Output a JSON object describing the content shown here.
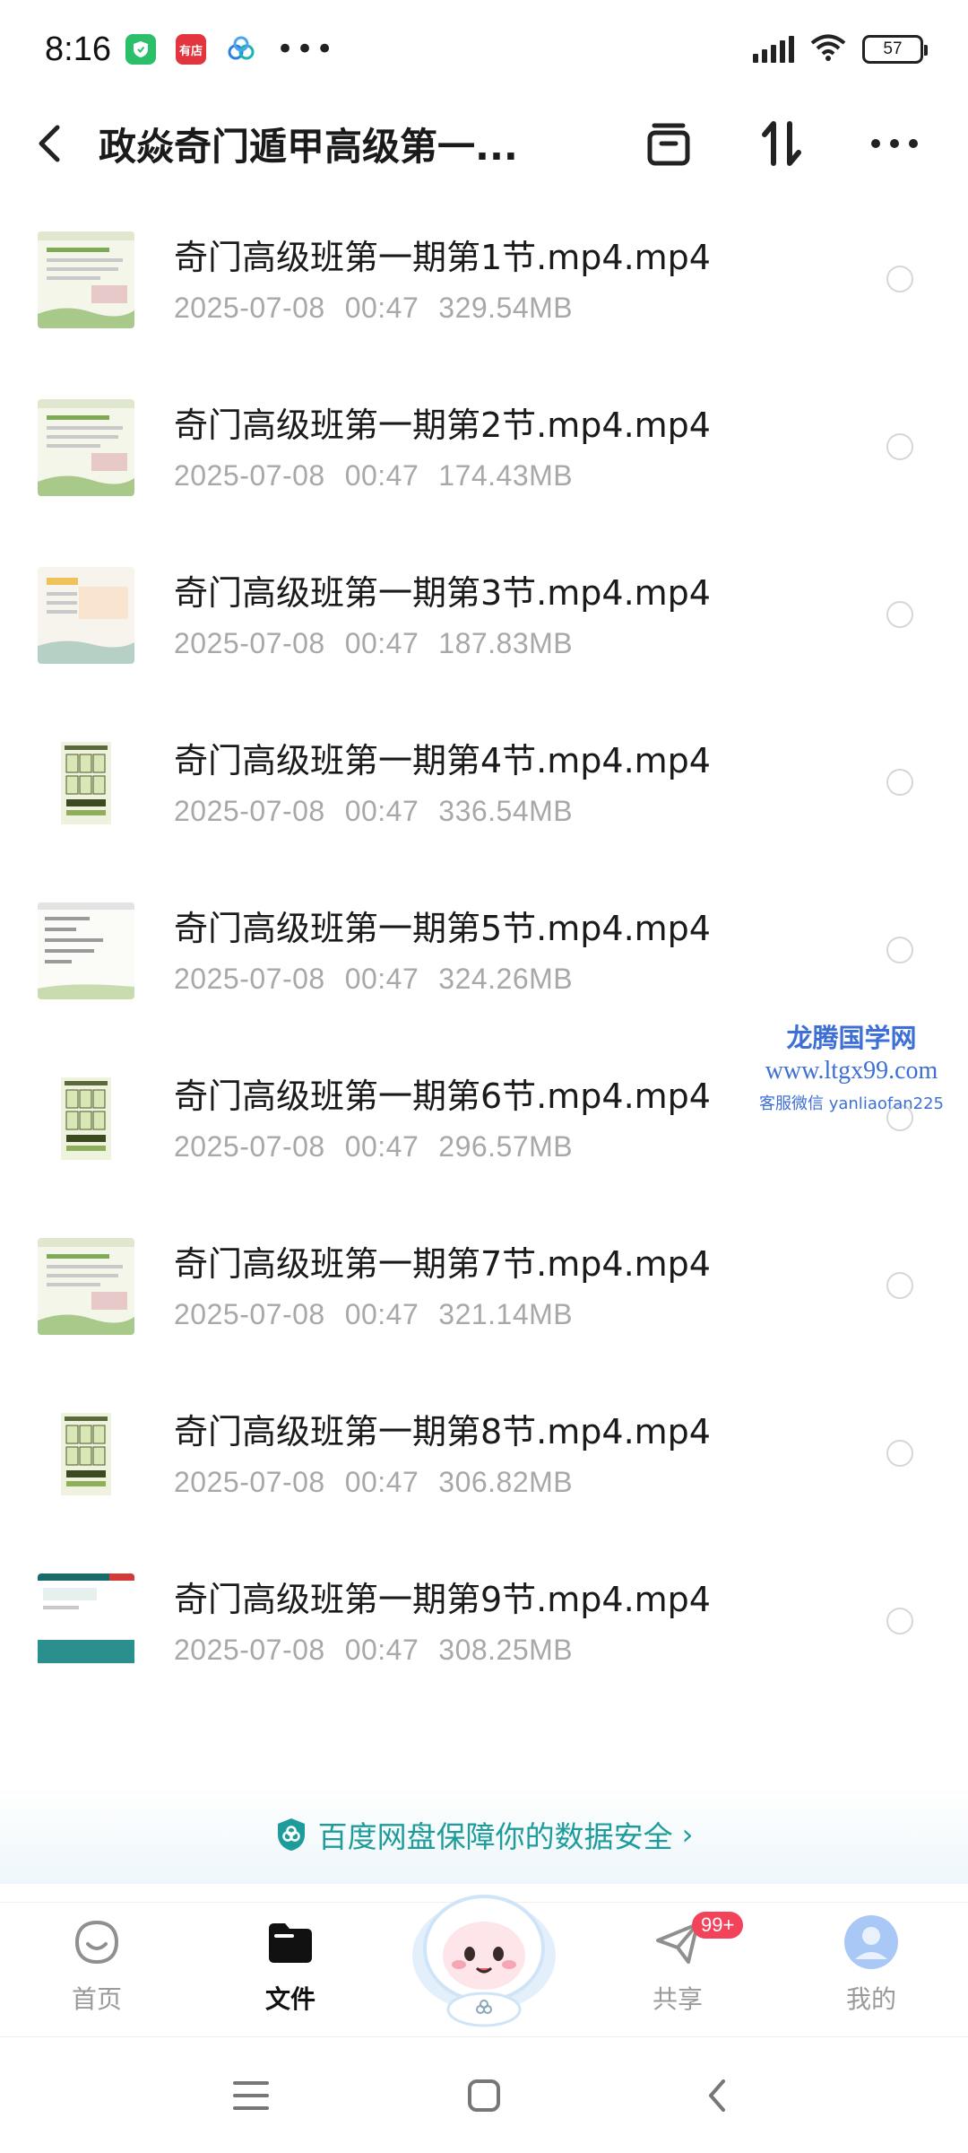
{
  "status_bar": {
    "time": "8:16",
    "notif_red_label": "有店",
    "dots": "•••",
    "battery": "57"
  },
  "header": {
    "title": "政焱奇门遁甲高级第一..."
  },
  "files": [
    {
      "name": "奇门高级班第一期第1节.mp4.mp4",
      "date": "2025-07-08",
      "time": "00:47",
      "size": "329.54MB",
      "thumb": "green"
    },
    {
      "name": "奇门高级班第一期第2节.mp4.mp4",
      "date": "2025-07-08",
      "time": "00:47",
      "size": "174.43MB",
      "thumb": "green"
    },
    {
      "name": "奇门高级班第一期第3节.mp4.mp4",
      "date": "2025-07-08",
      "time": "00:47",
      "size": "187.83MB",
      "thumb": "orange"
    },
    {
      "name": "奇门高级班第一期第4节.mp4.mp4",
      "date": "2025-07-08",
      "time": "00:47",
      "size": "336.54MB",
      "thumb": "chart"
    },
    {
      "name": "奇门高级班第一期第5节.mp4.mp4",
      "date": "2025-07-08",
      "time": "00:47",
      "size": "324.26MB",
      "thumb": "text"
    },
    {
      "name": "奇门高级班第一期第6节.mp4.mp4",
      "date": "2025-07-08",
      "time": "00:47",
      "size": "296.57MB",
      "thumb": "chart"
    },
    {
      "name": "奇门高级班第一期第7节.mp4.mp4",
      "date": "2025-07-08",
      "time": "00:47",
      "size": "321.14MB",
      "thumb": "green"
    },
    {
      "name": "奇门高级班第一期第8节.mp4.mp4",
      "date": "2025-07-08",
      "time": "00:47",
      "size": "306.82MB",
      "thumb": "chart"
    },
    {
      "name": "奇门高级班第一期第9节.mp4.mp4",
      "date": "2025-07-08",
      "time": "00:47",
      "size": "308.25MB",
      "thumb": "teal"
    }
  ],
  "watermark": {
    "line1": "龙腾国学网",
    "line2": "www.ltgx99.com",
    "line3": "客服微信 yanliaofan225"
  },
  "safety_banner": {
    "text": "百度网盘保障你的数据安全",
    "arrow": "›"
  },
  "bottom_nav": {
    "home": "首页",
    "files": "文件",
    "share": "共享",
    "share_badge": "99+",
    "mine": "我的"
  },
  "colors": {
    "accent_teal": "#1e9c9b",
    "badge_red": "#f2435b",
    "watermark_blue": "#3d6fd6",
    "meta_gray": "#a8a8a8"
  }
}
